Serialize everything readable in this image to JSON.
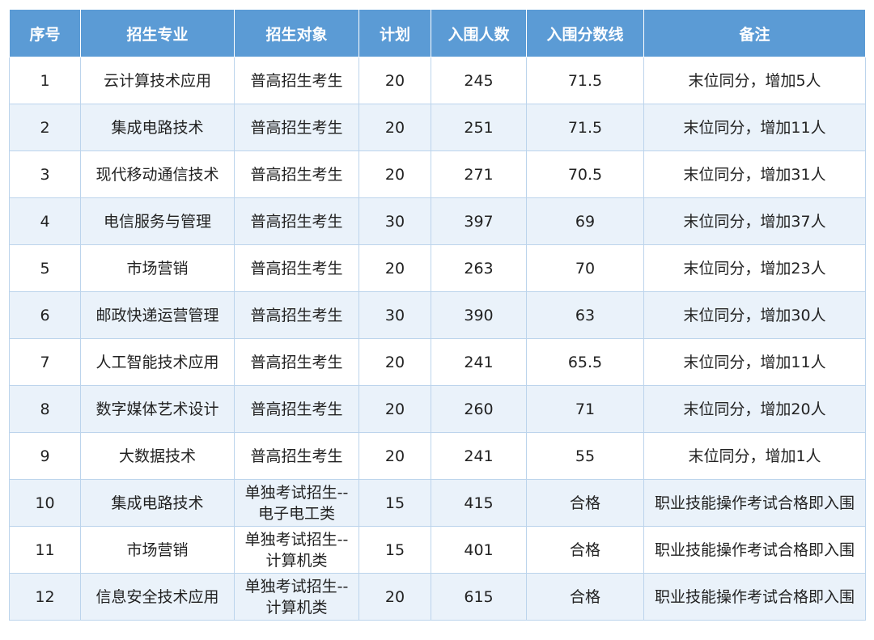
{
  "table": {
    "headers": [
      "序号",
      "招生专业",
      "招生对象",
      "计划",
      "入围人数",
      "入围分数线",
      "备注"
    ],
    "rows": [
      {
        "no": "1",
        "major": "云计算技术应用",
        "target": [
          "普高招生考生"
        ],
        "plan": "20",
        "count": "245",
        "score": "71.5",
        "note": "末位同分，增加5人"
      },
      {
        "no": "2",
        "major": "集成电路技术",
        "target": [
          "普高招生考生"
        ],
        "plan": "20",
        "count": "251",
        "score": "71.5",
        "note": "末位同分，增加11人"
      },
      {
        "no": "3",
        "major": "现代移动通信技术",
        "target": [
          "普高招生考生"
        ],
        "plan": "20",
        "count": "271",
        "score": "70.5",
        "note": "末位同分，增加31人"
      },
      {
        "no": "4",
        "major": "电信服务与管理",
        "target": [
          "普高招生考生"
        ],
        "plan": "30",
        "count": "397",
        "score": "69",
        "note": "末位同分，增加37人"
      },
      {
        "no": "5",
        "major": "市场营销",
        "target": [
          "普高招生考生"
        ],
        "plan": "20",
        "count": "263",
        "score": "70",
        "note": "末位同分，增加23人"
      },
      {
        "no": "6",
        "major": "邮政快递运营管理",
        "target": [
          "普高招生考生"
        ],
        "plan": "30",
        "count": "390",
        "score": "63",
        "note": "末位同分，增加30人"
      },
      {
        "no": "7",
        "major": "人工智能技术应用",
        "target": [
          "普高招生考生"
        ],
        "plan": "20",
        "count": "241",
        "score": "65.5",
        "note": "末位同分，增加11人"
      },
      {
        "no": "8",
        "major": "数字媒体艺术设计",
        "target": [
          "普高招生考生"
        ],
        "plan": "20",
        "count": "260",
        "score": "71",
        "note": "末位同分，增加20人"
      },
      {
        "no": "9",
        "major": "大数据技术",
        "target": [
          "普高招生考生"
        ],
        "plan": "20",
        "count": "241",
        "score": "55",
        "note": "末位同分，增加1人"
      },
      {
        "no": "10",
        "major": "集成电路技术",
        "target": [
          "单独考试招生--",
          "电子电工类"
        ],
        "plan": "15",
        "count": "415",
        "score": "合格",
        "note": "职业技能操作考试合格即入围"
      },
      {
        "no": "11",
        "major": "市场营销",
        "target": [
          "单独考试招生--",
          "计算机类"
        ],
        "plan": "15",
        "count": "401",
        "score": "合格",
        "note": "职业技能操作考试合格即入围"
      },
      {
        "no": "12",
        "major": "信息安全技术应用",
        "target": [
          "单独考试招生--",
          "计算机类"
        ],
        "plan": "20",
        "count": "615",
        "score": "合格",
        "note": "职业技能操作考试合格即入围"
      }
    ]
  }
}
